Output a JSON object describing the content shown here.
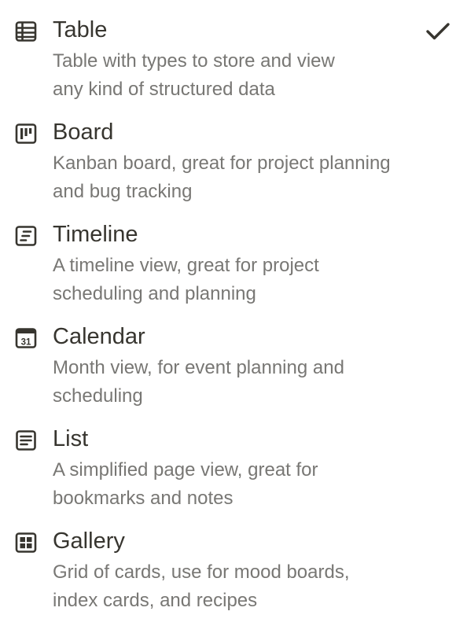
{
  "view_options": [
    {
      "icon": "table-icon",
      "title": "Table",
      "description_lines": [
        "Table with types to store and view",
        "any kind of structured data"
      ],
      "selected": true
    },
    {
      "icon": "board-icon",
      "title": "Board",
      "description_lines": [
        "Kanban board, great for project planning",
        "and bug tracking"
      ],
      "selected": false
    },
    {
      "icon": "timeline-icon",
      "title": "Timeline",
      "description_lines": [
        "A timeline view, great for project",
        "scheduling and planning"
      ],
      "selected": false
    },
    {
      "icon": "calendar-icon",
      "title": "Calendar",
      "calendar_icon_text": "31",
      "description_lines": [
        "Month view, for event planning and",
        "scheduling"
      ],
      "selected": false
    },
    {
      "icon": "list-icon",
      "title": "List",
      "description_lines": [
        "A simplified page view, great for",
        "bookmarks and notes"
      ],
      "selected": false
    },
    {
      "icon": "gallery-icon",
      "title": "Gallery",
      "description_lines": [
        "Grid of cards, use for mood boards,",
        "index cards, and recipes"
      ],
      "selected": false
    }
  ],
  "selected_indicator_icon": "checkmark-icon",
  "colors": {
    "title_text": "#37352f",
    "description_text": "#787774",
    "icon": "#37352f",
    "background": "#ffffff"
  }
}
